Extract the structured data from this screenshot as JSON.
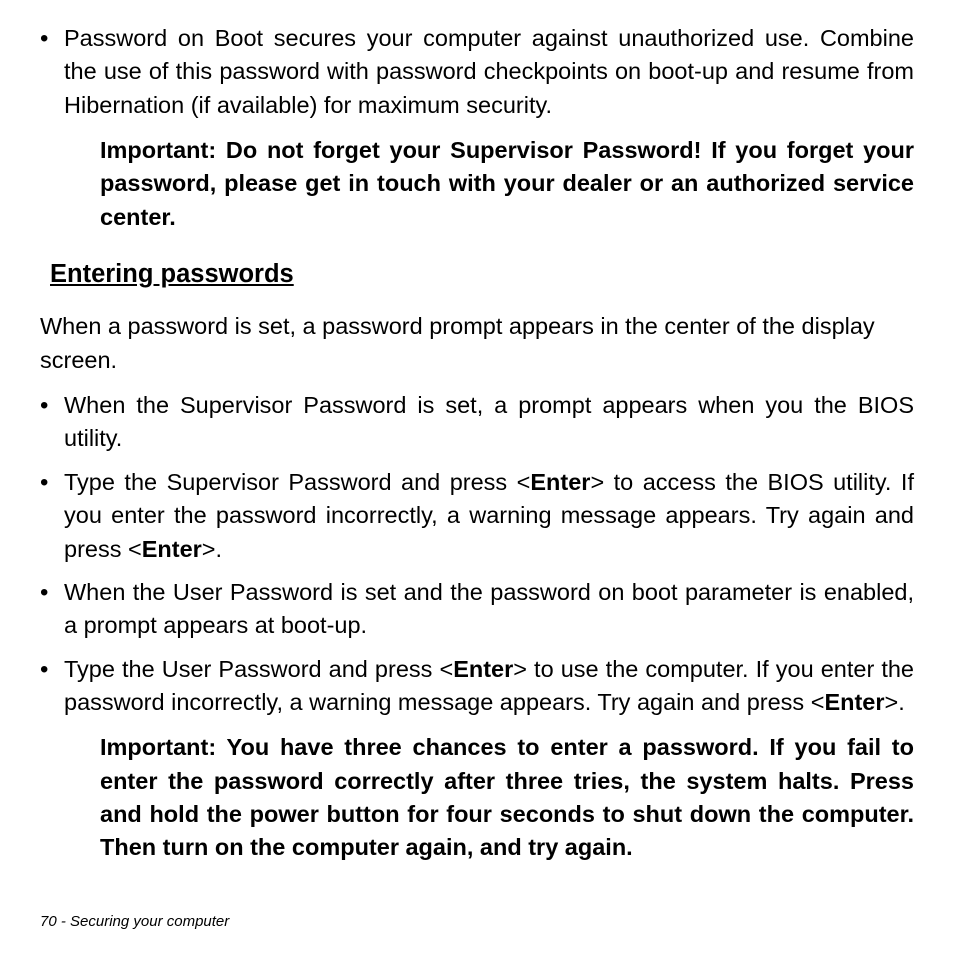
{
  "bullets_top": [
    "Password on Boot secures your computer against unauthorized use. Combine the use of this password with password checkpoints on boot-up and resume from Hibernation (if available) for maximum security."
  ],
  "important_top": "Important: Do not forget your Supervisor Password! If you forget your password, please get in touch with your dealer or an authorized service center.",
  "heading": "Entering passwords",
  "intro": "When a password is set, a password prompt appears in the center of the display screen.",
  "bullets_mid": {
    "b1": "When the Supervisor Password is set, a prompt appears when you the BIOS utility.",
    "b2_a": "Type the Supervisor Password and press <",
    "b2_key1": "Enter",
    "b2_b": "> to access the BIOS utility. If you enter the password incorrectly, a warning message appears. Try again and press <",
    "b2_key2": "Enter",
    "b2_c": ">.",
    "b3": "When the User Password is set and the password on boot parameter is enabled, a prompt appears at boot-up.",
    "b4_a": "Type the User Password and press <",
    "b4_key1": "Enter",
    "b4_b": "> to use the computer. If you enter the password incorrectly, a warning message appears. Try again and press <",
    "b4_key2": "Enter",
    "b4_c": ">."
  },
  "important_bottom": "Important: You have three chances to enter a password. If you fail to enter the password correctly after three tries, the system halts. Press and hold the power button for four seconds to shut down the computer. Then turn on the computer again, and try again.",
  "footer": "70 - Securing your computer"
}
